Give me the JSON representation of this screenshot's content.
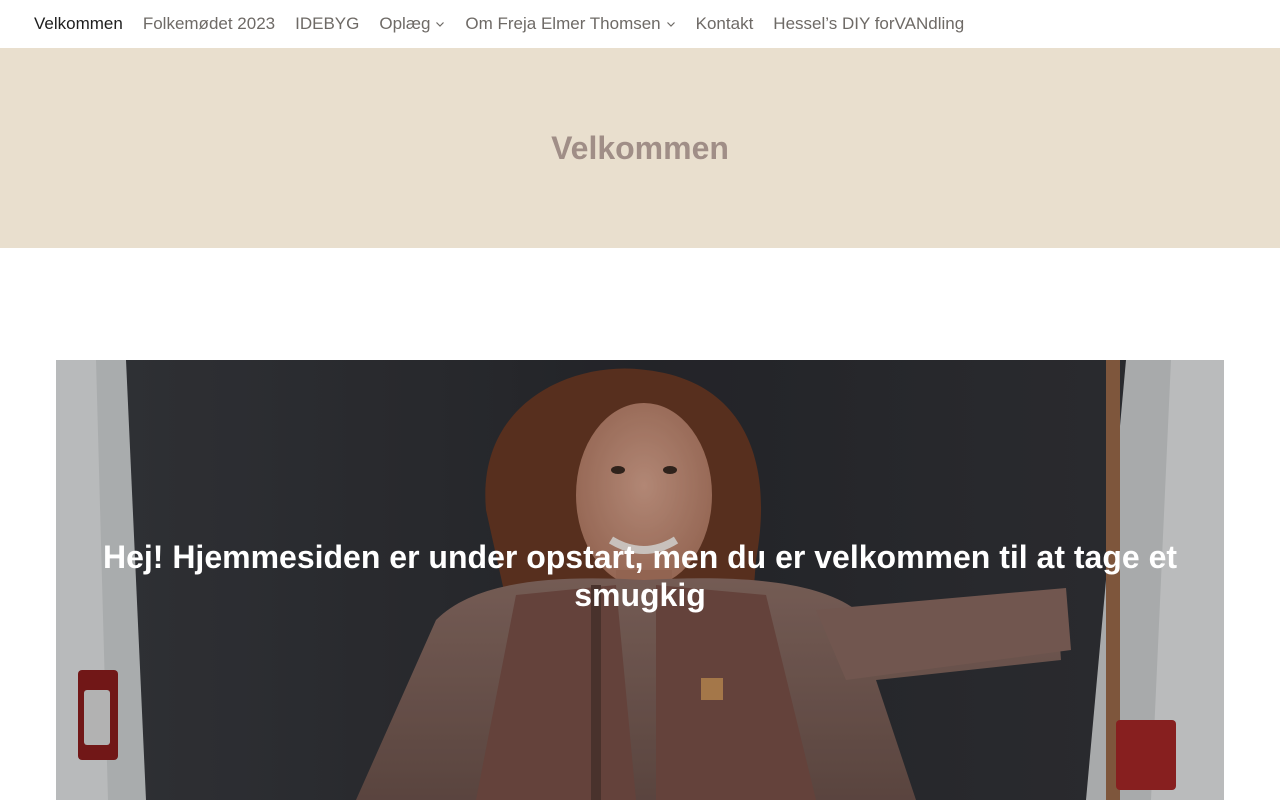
{
  "nav": {
    "items": [
      {
        "label": "Velkommen",
        "active": true,
        "has_dropdown": false
      },
      {
        "label": "Folkemødet 2023",
        "active": false,
        "has_dropdown": false
      },
      {
        "label": "IDEBYG",
        "active": false,
        "has_dropdown": false
      },
      {
        "label": "Oplæg",
        "active": false,
        "has_dropdown": true
      },
      {
        "label": "Om Freja Elmer Thomsen",
        "active": false,
        "has_dropdown": true
      },
      {
        "label": "Kontakt",
        "active": false,
        "has_dropdown": false
      },
      {
        "label": "Hessel’s DIY forVANdling",
        "active": false,
        "has_dropdown": false
      }
    ]
  },
  "hero": {
    "title": "Velkommen"
  },
  "cover": {
    "heading": "Hej! Hjemmesiden er under opstart, men du er velkommen til at tage et smugkig"
  },
  "colors": {
    "hero_background": "#e9dfce",
    "hero_title": "#a08e87",
    "nav_text": "#6e6a66",
    "nav_active": "#1e1e1e"
  }
}
